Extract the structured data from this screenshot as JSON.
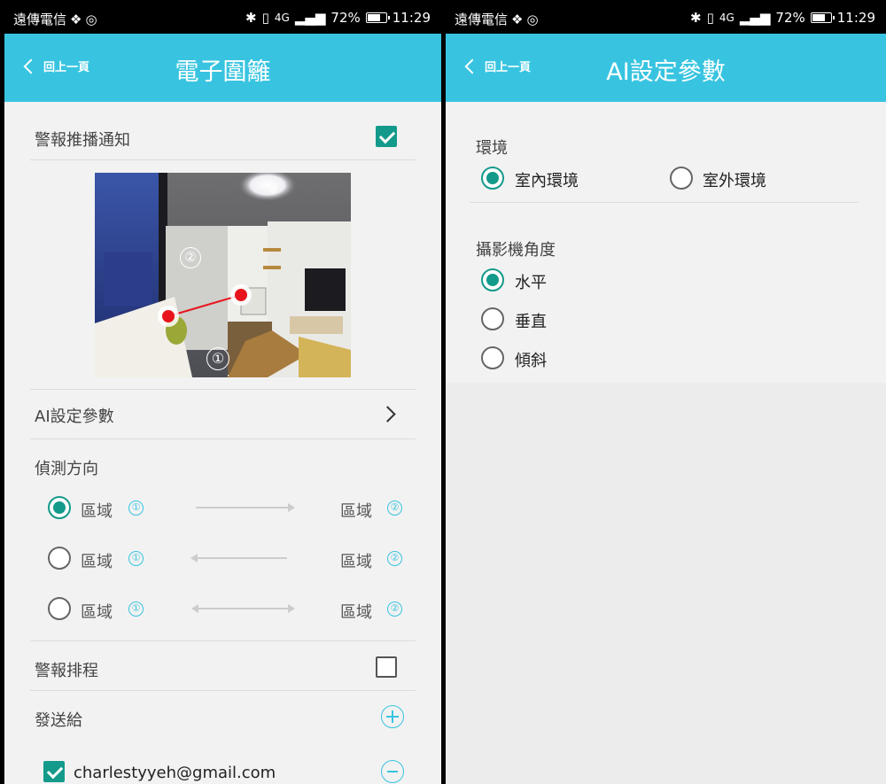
{
  "status": {
    "carrier": "遠傳電信",
    "network": "4G",
    "battery": "72%",
    "battery_level": 0.72,
    "time": "11:29"
  },
  "geofence": {
    "back_label": "回上一頁",
    "title": "電子圍籬",
    "alert_push": {
      "label": "警報推播通知",
      "checked": true
    },
    "ai_settings": "AI設定參數",
    "direction": {
      "title": "偵測方向",
      "options": [
        {
          "from": "區域",
          "from_num": "①",
          "to": "區域",
          "to_num": "②",
          "direction": "right",
          "selected": true
        },
        {
          "from": "區域",
          "from_num": "①",
          "to": "區域",
          "to_num": "②",
          "direction": "left",
          "selected": false
        },
        {
          "from": "區域",
          "from_num": "①",
          "to": "區域",
          "to_num": "②",
          "direction": "both",
          "selected": false
        }
      ]
    },
    "schedule": {
      "label": "警報排程",
      "checked": false
    },
    "send_to": {
      "label": "發送給"
    },
    "recipients": [
      {
        "email": "charlestyyeh@gmail.com",
        "checked": true
      }
    ],
    "zone_markers": [
      "②",
      "①"
    ]
  },
  "ai": {
    "back_label": "回上一頁",
    "title": "AI設定參數",
    "environment": {
      "title": "環境",
      "options": [
        {
          "label": "室內環境",
          "selected": true
        },
        {
          "label": "室外環境",
          "selected": false
        }
      ]
    },
    "angle": {
      "title": "攝影機角度",
      "options": [
        {
          "label": "水平",
          "selected": true
        },
        {
          "label": "垂直",
          "selected": false
        },
        {
          "label": "傾斜",
          "selected": false
        }
      ]
    }
  },
  "colors": {
    "accent": "#38c4e0",
    "teal": "#139a8a",
    "marker": "#e8141c"
  }
}
